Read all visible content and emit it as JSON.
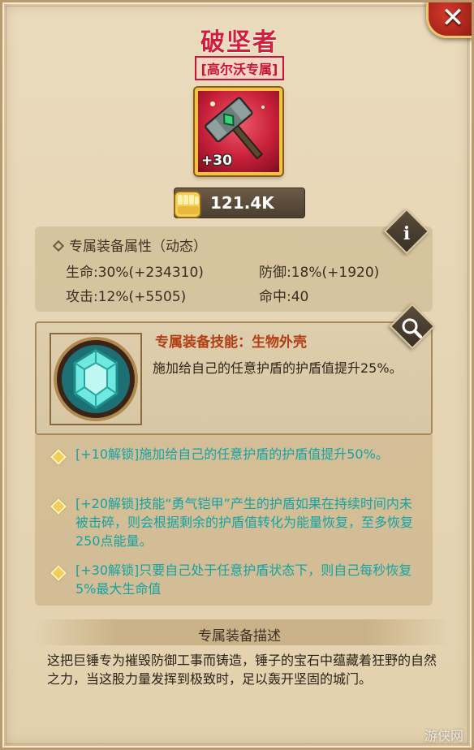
{
  "item": {
    "title": "破坚者",
    "subtitle": "[高尔沃专属]",
    "level_badge": "+30",
    "icon": "hammer-icon",
    "rarity_color": "#c8203a"
  },
  "power": {
    "icon": "fist-icon",
    "value": "121.4K"
  },
  "attributes": {
    "header": "专属装备属性（动态）",
    "hp": "生命:30%(+234310)",
    "defense": "防御:18%(+1920)",
    "attack": "攻击:12%(+5505)",
    "accuracy": "命中:40"
  },
  "skill": {
    "name": "专属装备技能：生物外壳",
    "description": "施加给自己的任意护盾的护盾值提升25%。",
    "icon": "crystal-shell-icon"
  },
  "unlocks": [
    {
      "text": "[+10解锁]施加给自己的任意护盾的护盾值提升50%。"
    },
    {
      "text": "[+20解锁]技能“勇气铠甲”产生的护盾如果在持续时间内未被击碎，则会根据剩余的护盾值转化为能量恢复，至多恢复250点能量。"
    },
    {
      "text": "[+30解锁]只要自己处于任意护盾状态下，则自己每秒恢复5%最大生命值"
    }
  ],
  "description": {
    "header": "专属装备描述",
    "text": "这把巨锤专为摧毁防御工事而铸造，锤子的宝石中蕴藏着狂野的自然之力，当这股力量发挥到极致时，足以轰开坚固的城门。"
  },
  "buttons": {
    "close": "✕",
    "info": "i"
  },
  "watermark": "游侠网",
  "colors": {
    "title": "#cf1f3a",
    "unlock_text": "#14a3a3",
    "skill_name": "#b23e14"
  }
}
